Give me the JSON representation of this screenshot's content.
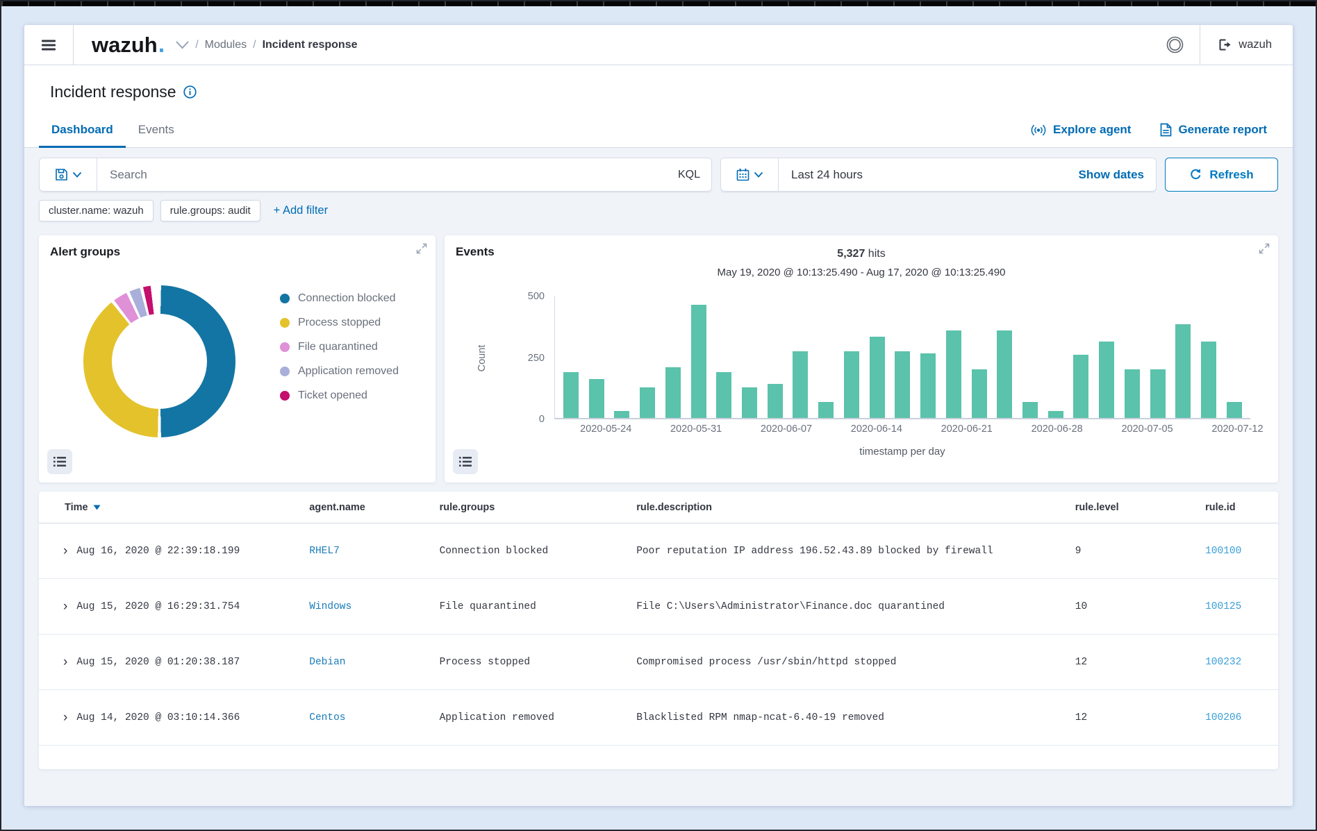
{
  "nav": {
    "logo_text": "wazuh",
    "logo_dot": ".",
    "breadcrumb": {
      "sep1": "/",
      "section": "Modules",
      "sep2": "/",
      "page": "Incident response"
    },
    "user_label": "wazuh"
  },
  "page": {
    "title": "Incident response"
  },
  "tabs": {
    "dashboard": "Dashboard",
    "events": "Events"
  },
  "header_actions": {
    "explore_agent": "Explore agent",
    "generate_report": "Generate report"
  },
  "query_bar": {
    "search_placeholder": "Search",
    "kql_label": "KQL",
    "time_range_value": "Last 24 hours",
    "show_dates_label": "Show dates",
    "refresh_label": "Refresh"
  },
  "filters": {
    "pills": [
      "cluster.name: wazuh",
      "rule.groups: audit"
    ],
    "add_filter_label": "+ Add filter"
  },
  "panels": {
    "alert_groups": {
      "title": "Alert groups"
    },
    "events": {
      "title": "Events",
      "hits_number": "5,327",
      "hits_suffix": " hits",
      "date_range": "May 19, 2020 @ 10:13:25.490 - Aug 17, 2020 @ 10:13:25.490"
    }
  },
  "chart_data": [
    {
      "type": "pie",
      "title": "Alert groups",
      "donut": true,
      "legend_position": "right",
      "labels": [
        "Connection blocked",
        "Process stopped",
        "File quarantined",
        "Application removed",
        "Ticket opened"
      ],
      "values": [
        50.0,
        39.5,
        3.7,
        3.0,
        2.3
      ],
      "unit": "percent-share",
      "colors": [
        "#1375a3",
        "#e4c22c",
        "#df90d7",
        "#a9afda",
        "#c40f6e"
      ]
    },
    {
      "type": "bar",
      "title": "Events count histogram",
      "ylabel": "Count",
      "xlabel": "timestamp per day",
      "ylim": [
        0,
        500
      ],
      "yticks": [
        0,
        250,
        500
      ],
      "grid": false,
      "bar_color": "#5bc2ab",
      "x_tick_labels": [
        "2020-05-24",
        "2020-05-31",
        "2020-06-07",
        "2020-06-14",
        "2020-06-21",
        "2020-06-28",
        "2020-07-05",
        "2020-07-12"
      ],
      "values": [
        190,
        160,
        30,
        125,
        210,
        465,
        190,
        125,
        140,
        275,
        65,
        275,
        335,
        275,
        265,
        360,
        200,
        360,
        65,
        30,
        260,
        315,
        200,
        200,
        385,
        315,
        65
      ]
    }
  ],
  "table": {
    "columns": [
      "Time",
      "agent.name",
      "rule.groups",
      "rule.description",
      "rule.level",
      "rule.id"
    ],
    "sorted_column": "Time",
    "rows": [
      {
        "time": "Aug 16, 2020 @ 22:39:18.199",
        "agent": "RHEL7",
        "groups": "Connection blocked",
        "description": "Poor reputation IP address 196.52.43.89 blocked by firewall",
        "level": "9",
        "id": "100100"
      },
      {
        "time": "Aug 15, 2020 @ 16:29:31.754",
        "agent": "Windows",
        "groups": "File quarantined",
        "description": "File C:\\Users\\Administrator\\Finance.doc quarantined",
        "level": "10",
        "id": "100125"
      },
      {
        "time": "Aug 15, 2020 @ 01:20:38.187",
        "agent": "Debian",
        "groups": "Process stopped",
        "description": "Compromised process /usr/sbin/httpd stopped",
        "level": "12",
        "id": "100232"
      },
      {
        "time": "Aug 14, 2020 @ 03:10:14.366",
        "agent": "Centos",
        "groups": "Application removed",
        "description": "Blacklisted RPM nmap-ncat-6.40-19 removed",
        "level": "12",
        "id": "100206"
      }
    ]
  },
  "colors": {
    "accent": "#006BB4",
    "bar_teal": "#5bc2ab",
    "frame_background": "#dde8f7"
  }
}
